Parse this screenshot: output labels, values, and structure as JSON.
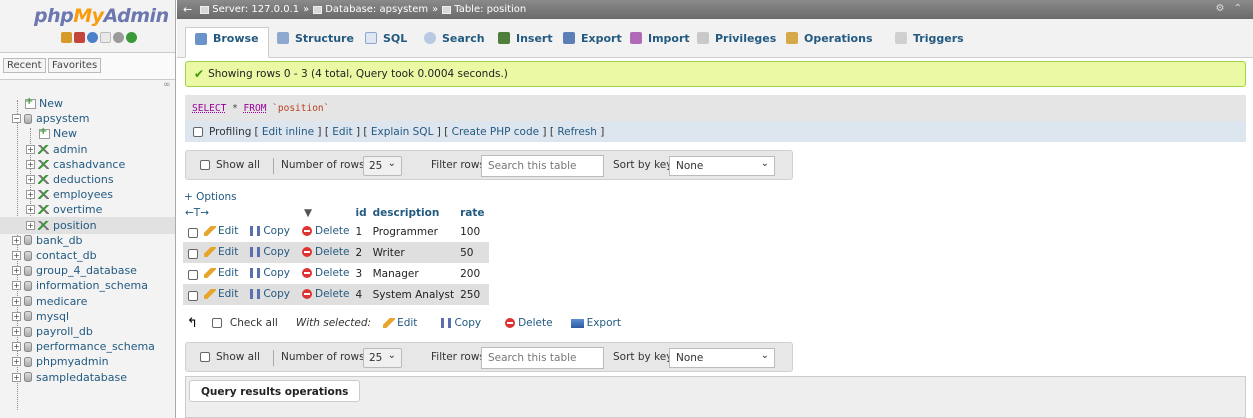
{
  "logo": {
    "part1": "php",
    "part2": "My",
    "part3": "Admin"
  },
  "nav": {
    "tabs": [
      "Recent",
      "Favorites"
    ],
    "link_icon": "∞",
    "tree": [
      {
        "label": "New",
        "kind": "new",
        "level": 0
      },
      {
        "label": "apsystem",
        "kind": "db",
        "level": 0,
        "expanded": true
      },
      {
        "label": "New",
        "kind": "new",
        "level": 1
      },
      {
        "label": "admin",
        "kind": "table",
        "level": 1
      },
      {
        "label": "cashadvance",
        "kind": "table",
        "level": 1
      },
      {
        "label": "deductions",
        "kind": "table",
        "level": 1
      },
      {
        "label": "employees",
        "kind": "table",
        "level": 1
      },
      {
        "label": "overtime",
        "kind": "table",
        "level": 1
      },
      {
        "label": "position",
        "kind": "table",
        "level": 1,
        "selected": true
      },
      {
        "label": "bank_db",
        "kind": "db",
        "level": 0
      },
      {
        "label": "contact_db",
        "kind": "db",
        "level": 0
      },
      {
        "label": "group_4_database",
        "kind": "db",
        "level": 0
      },
      {
        "label": "information_schema",
        "kind": "db",
        "level": 0
      },
      {
        "label": "medicare",
        "kind": "db",
        "level": 0
      },
      {
        "label": "mysql",
        "kind": "db",
        "level": 0
      },
      {
        "label": "payroll_db",
        "kind": "db",
        "level": 0
      },
      {
        "label": "performance_schema",
        "kind": "db",
        "level": 0
      },
      {
        "label": "phpmyadmin",
        "kind": "db",
        "level": 0
      },
      {
        "label": "sampledatabase",
        "kind": "db",
        "level": 0
      }
    ]
  },
  "breadcrumb": {
    "server": "Server: 127.0.0.1",
    "database": "Database: apsystem",
    "table": "Table: position",
    "sep": "»",
    "right_icons": "⚙ ⌃"
  },
  "menu": {
    "tabs": [
      "Browse",
      "Structure",
      "SQL",
      "Search",
      "Insert",
      "Export",
      "Import",
      "Privileges",
      "Operations",
      "Triggers"
    ],
    "active": "Browse"
  },
  "success": {
    "text": "Showing rows 0 - 3 (4 total, Query took 0.0004 seconds.)"
  },
  "sql": {
    "kw1": "SELECT",
    "star": "*",
    "kw2": "FROM",
    "table": "`position`"
  },
  "profiling": {
    "label": "Profiling",
    "links": [
      "Edit inline",
      "Edit",
      "Explain SQL",
      "Create PHP code",
      "Refresh"
    ]
  },
  "navbar": {
    "show_all": "Show all",
    "num_rows_label": "Number of rows:",
    "num_rows_value": "25",
    "filter_label": "Filter rows:",
    "filter_placeholder": "Search this table",
    "sort_label": "Sort by key:",
    "sort_value": "None"
  },
  "options_link": "+ Options",
  "table": {
    "col_arrows": "←T→",
    "sort_icon": "▼",
    "headers": [
      "id",
      "description",
      "rate"
    ],
    "actions": {
      "edit": "Edit",
      "copy": "Copy",
      "delete": "Delete"
    },
    "rows": [
      {
        "id": "1",
        "description": "Programmer",
        "rate": "100"
      },
      {
        "id": "2",
        "description": "Writer",
        "rate": "50"
      },
      {
        "id": "3",
        "description": "Manager",
        "rate": "200"
      },
      {
        "id": "4",
        "description": "System Analyst",
        "rate": "250"
      }
    ]
  },
  "bulk": {
    "check_all": "Check all",
    "with_selected": "With selected:",
    "edit": "Edit",
    "copy": "Copy",
    "delete": "Delete",
    "export": "Export"
  },
  "qro": {
    "title": "Query results operations"
  }
}
